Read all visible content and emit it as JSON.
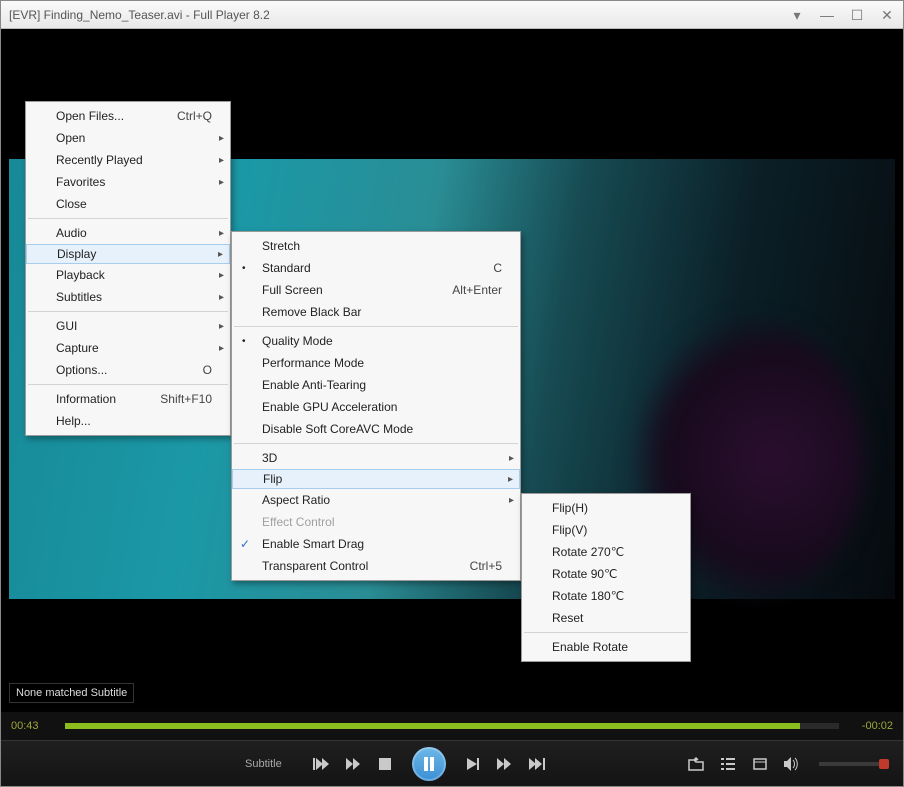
{
  "titlebar": {
    "text": "[EVR] Finding_Nemo_Teaser.avi - Full Player 8.2"
  },
  "subtitle_msg": "None matched Subtitle",
  "time": {
    "current": "00:43",
    "remaining": "-00:02"
  },
  "controls": {
    "subtitle_label": "Subtitle"
  },
  "main_menu": {
    "open_files": "Open Files...",
    "open_files_sc": "Ctrl+Q",
    "open": "Open",
    "recently": "Recently Played",
    "favorites": "Favorites",
    "close": "Close",
    "audio": "Audio",
    "display": "Display",
    "playback": "Playback",
    "subtitles": "Subtitles",
    "gui": "GUI",
    "capture": "Capture",
    "options": "Options...",
    "options_sc": "O",
    "information": "Information",
    "information_sc": "Shift+F10",
    "help": "Help..."
  },
  "display_menu": {
    "stretch": "Stretch",
    "standard": "Standard",
    "standard_sc": "C",
    "fullscreen": "Full Screen",
    "fullscreen_sc": "Alt+Enter",
    "remove_bar": "Remove Black Bar",
    "quality": "Quality Mode",
    "performance": "Performance Mode",
    "anti_tearing": "Enable Anti-Tearing",
    "gpu": "Enable GPU Acceleration",
    "disable_avc": "Disable Soft CoreAVC Mode",
    "three_d": "3D",
    "flip": "Flip",
    "aspect": "Aspect Ratio",
    "effect": "Effect Control",
    "smart_drag": "Enable Smart Drag",
    "transparent": "Transparent Control",
    "transparent_sc": "Ctrl+5"
  },
  "flip_menu": {
    "flip_h": "Flip(H)",
    "flip_v": "Flip(V)",
    "rot270": "Rotate 270℃",
    "rot90": "Rotate 90℃",
    "rot180": "Rotate 180℃",
    "reset": "Reset",
    "enable_rotate": "Enable Rotate"
  }
}
